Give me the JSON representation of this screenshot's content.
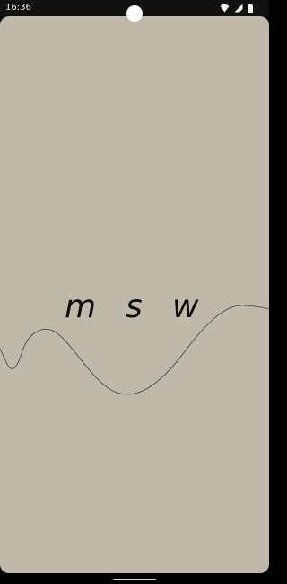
{
  "status_bar": {
    "time": "16:36",
    "icons": [
      "wifi-icon",
      "cellular-signal-icon",
      "battery-icon"
    ]
  },
  "main": {
    "letters": [
      "m",
      "s",
      "w"
    ],
    "background_color": "#c0b9aa",
    "wave_color": "#3a3a3a"
  }
}
